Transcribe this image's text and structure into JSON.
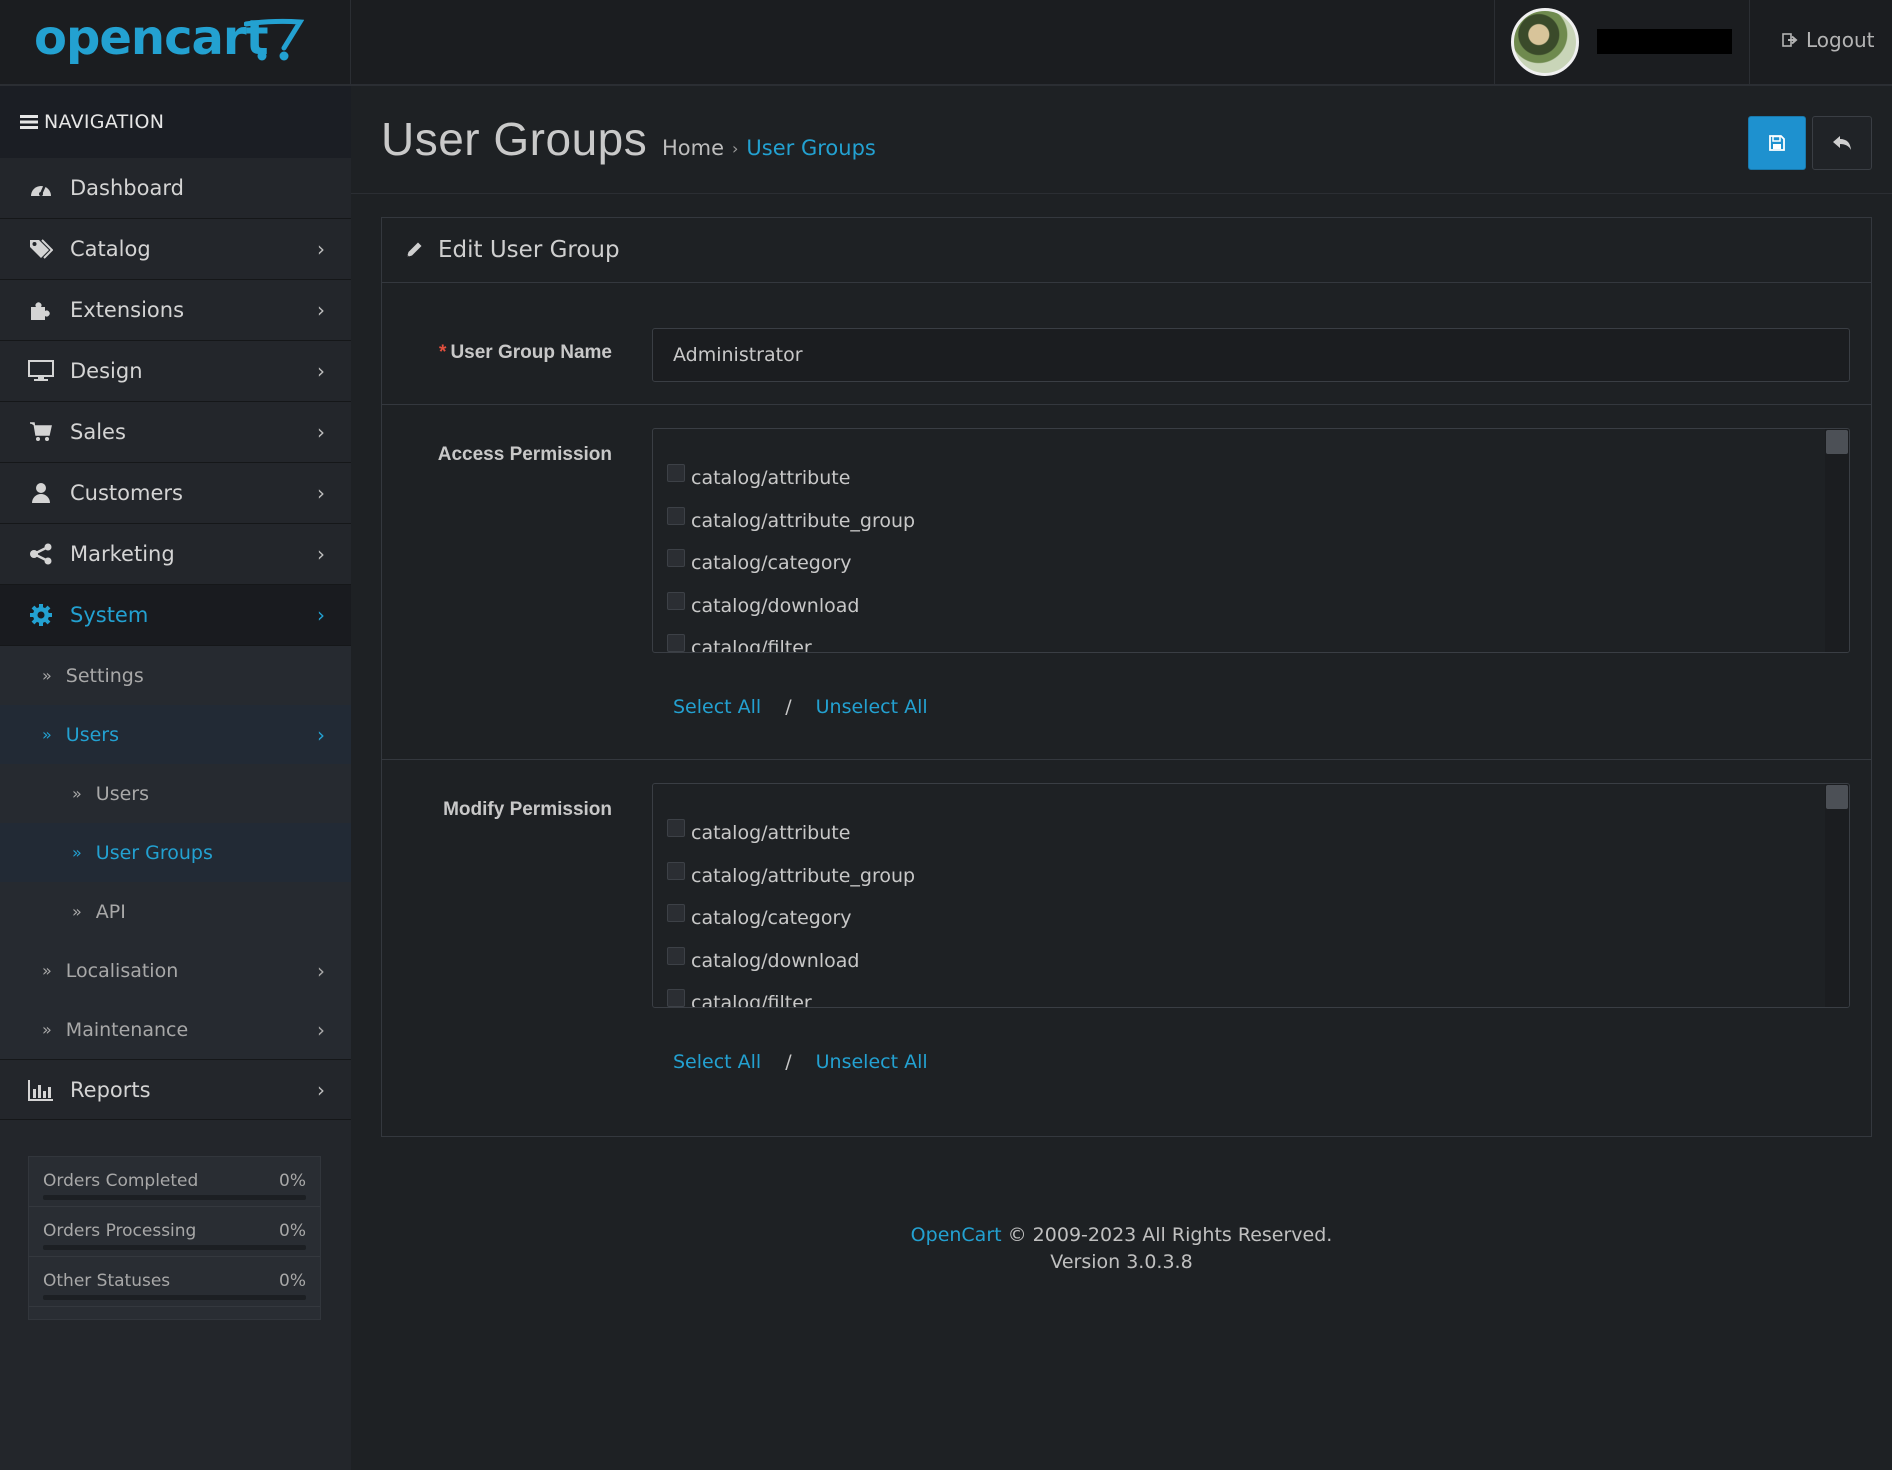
{
  "header": {
    "brand": "opencart",
    "logout_label": "Logout"
  },
  "sidebar": {
    "nav_heading": "NAVIGATION",
    "items": [
      {
        "label": "Dashboard",
        "icon": "dashboard-icon"
      },
      {
        "label": "Catalog",
        "icon": "tags-icon"
      },
      {
        "label": "Extensions",
        "icon": "puzzle-icon"
      },
      {
        "label": "Design",
        "icon": "monitor-icon"
      },
      {
        "label": "Sales",
        "icon": "cart-icon"
      },
      {
        "label": "Customers",
        "icon": "user-icon"
      },
      {
        "label": "Marketing",
        "icon": "share-icon"
      },
      {
        "label": "System",
        "icon": "gear-icon"
      }
    ],
    "system_sub": {
      "settings": "Settings",
      "users": "Users",
      "users_sub": [
        "Users",
        "User Groups",
        "API"
      ],
      "localisation": "Localisation",
      "maintenance": "Maintenance"
    },
    "reports": {
      "label": "Reports",
      "icon": "bar-chart-icon"
    },
    "stats": [
      {
        "label": "Orders Completed",
        "value": "0%",
        "progress": 0
      },
      {
        "label": "Orders Processing",
        "value": "0%",
        "progress": 0
      },
      {
        "label": "Other Statuses",
        "value": "0%",
        "progress": 0
      }
    ]
  },
  "page": {
    "title": "User Groups",
    "breadcrumb": {
      "home": "Home",
      "current": "User Groups"
    }
  },
  "panel": {
    "heading": "Edit User Group",
    "group_name_label": "User Group Name",
    "group_name_value": "Administrator",
    "access_label": "Access Permission",
    "modify_label": "Modify Permission",
    "access_items": [
      "catalog/attribute",
      "catalog/attribute_group",
      "catalog/category",
      "catalog/download",
      "catalog/filter"
    ],
    "modify_items": [
      "catalog/attribute",
      "catalog/attribute_group",
      "catalog/category",
      "catalog/download",
      "catalog/filter"
    ],
    "select_all": "Select All",
    "slash": "/",
    "unselect_all": "Unselect All"
  },
  "footer": {
    "brand_link": "OpenCart",
    "copyright": "© 2009-2023 All Rights Reserved.",
    "version": "Version 3.0.3.8"
  },
  "colors": {
    "accent": "#23a1d1",
    "primary_button": "#1e91cf",
    "background": "#1e2124",
    "sidebar": "#23262b",
    "required": "#e3503e"
  }
}
